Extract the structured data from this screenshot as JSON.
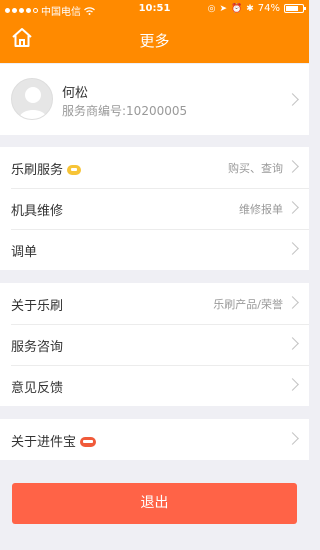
{
  "status": {
    "carrier": "中国电信",
    "time": "10:51",
    "battery": "74%",
    "battery_level": 0.74
  },
  "header": {
    "title": "更多",
    "home_icon": "home-icon"
  },
  "profile": {
    "name": "何松",
    "id_line": "服务商编号:10200005"
  },
  "menu": {
    "group1": [
      {
        "label": "乐刷服务",
        "detail": "购买、查询",
        "badge": "hot"
      },
      {
        "label": "机具维修",
        "detail": "维修报单"
      },
      {
        "label": "调单",
        "detail": ""
      }
    ],
    "group2": [
      {
        "label": "关于乐刷",
        "detail": "乐刷产品/荣誉"
      },
      {
        "label": "服务咨询",
        "detail": ""
      },
      {
        "label": "意见反馈",
        "detail": ""
      }
    ],
    "group3": [
      {
        "label": "关于进件宝",
        "detail": "",
        "badge": "new"
      }
    ]
  },
  "logout_label": "退出",
  "colors": {
    "brand": "#ff8a00",
    "logout": "#ff6347",
    "background": "#efeff4"
  }
}
